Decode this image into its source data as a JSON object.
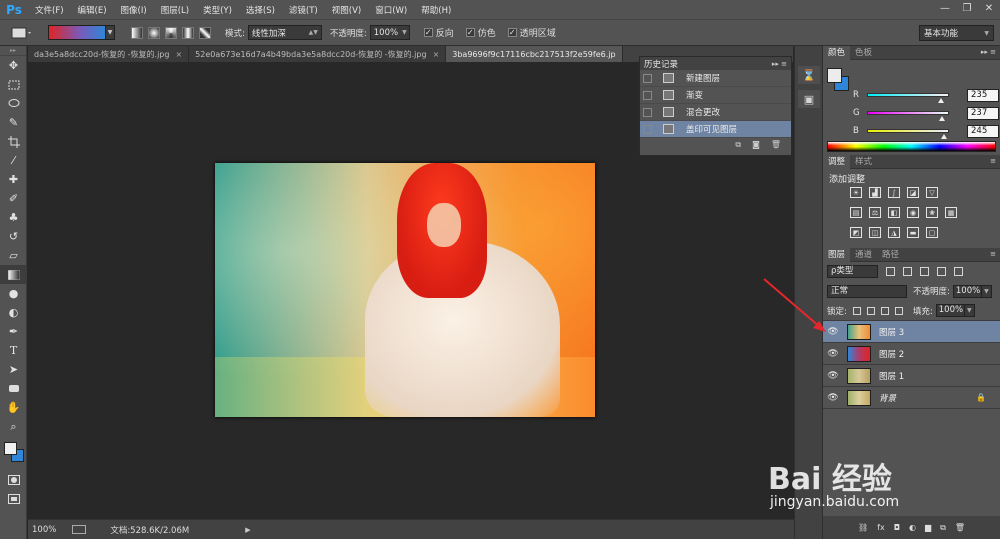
{
  "app": {
    "logo": "Ps"
  },
  "menu": [
    "文件(F)",
    "编辑(E)",
    "图像(I)",
    "图层(L)",
    "类型(Y)",
    "选择(S)",
    "滤镜(T)",
    "视图(V)",
    "窗口(W)",
    "帮助(H)"
  ],
  "window_controls": [
    "—",
    "❐",
    "✕"
  ],
  "options": {
    "mode_label": "模式:",
    "mode_value": "线性加深",
    "opacity_label": "不透明度:",
    "opacity_value": "100%",
    "reverse_label": "反向",
    "dither_label": "仿色",
    "transparency_label": "透明区域",
    "workspace": "基本功能"
  },
  "doc_tabs": [
    {
      "label": "da3e5a8dcc20d-恢复的 -恢复的.jpg",
      "active": false
    },
    {
      "label": "52e0a673e16d7a4b49bda3e5a8dcc20d-恢复的 -恢复的.jpg",
      "active": false
    },
    {
      "label": "3ba9696f9c17116cbc217513f2e59fe6.jp",
      "active": true
    }
  ],
  "status": {
    "zoom": "100%",
    "doc_size": "文档:528.6K/2.06M"
  },
  "history": {
    "title": "历史记录",
    "items": [
      {
        "label": "新建图层",
        "active": false
      },
      {
        "label": "渐变",
        "active": false
      },
      {
        "label": "混合更改",
        "active": false
      },
      {
        "label": "盖印可见图层",
        "active": true
      }
    ]
  },
  "color_panel": {
    "tabs": [
      "颜色",
      "色板"
    ],
    "r_label": "R",
    "g_label": "G",
    "b_label": "B",
    "r": "235",
    "g": "237",
    "b": "245",
    "fg_color": "#ececec",
    "bg_color": "#2f86d8"
  },
  "adjust_panel": {
    "tabs": [
      "调整",
      "样式"
    ],
    "title": "添加调整"
  },
  "layers_panel": {
    "tabs": [
      "图层",
      "通道",
      "路径"
    ],
    "filter": "ρ类型",
    "blend_mode": "正常",
    "opacity_label": "不透明度:",
    "opacity": "100%",
    "lock_label": "锁定:",
    "fill_label": "填充:",
    "fill": "100%",
    "layers": [
      {
        "name": "图层 3",
        "active": true
      },
      {
        "name": "图层 2",
        "active": false
      },
      {
        "name": "图层 1",
        "active": false
      },
      {
        "name": "背景",
        "active": false
      }
    ]
  },
  "watermark": {
    "logo": "Bai 经验",
    "url": "jingyan.baidu.com"
  },
  "colors": {
    "accent_selection": "#6f84a3",
    "panel_bg": "#535353",
    "app_bg": "#282828"
  }
}
